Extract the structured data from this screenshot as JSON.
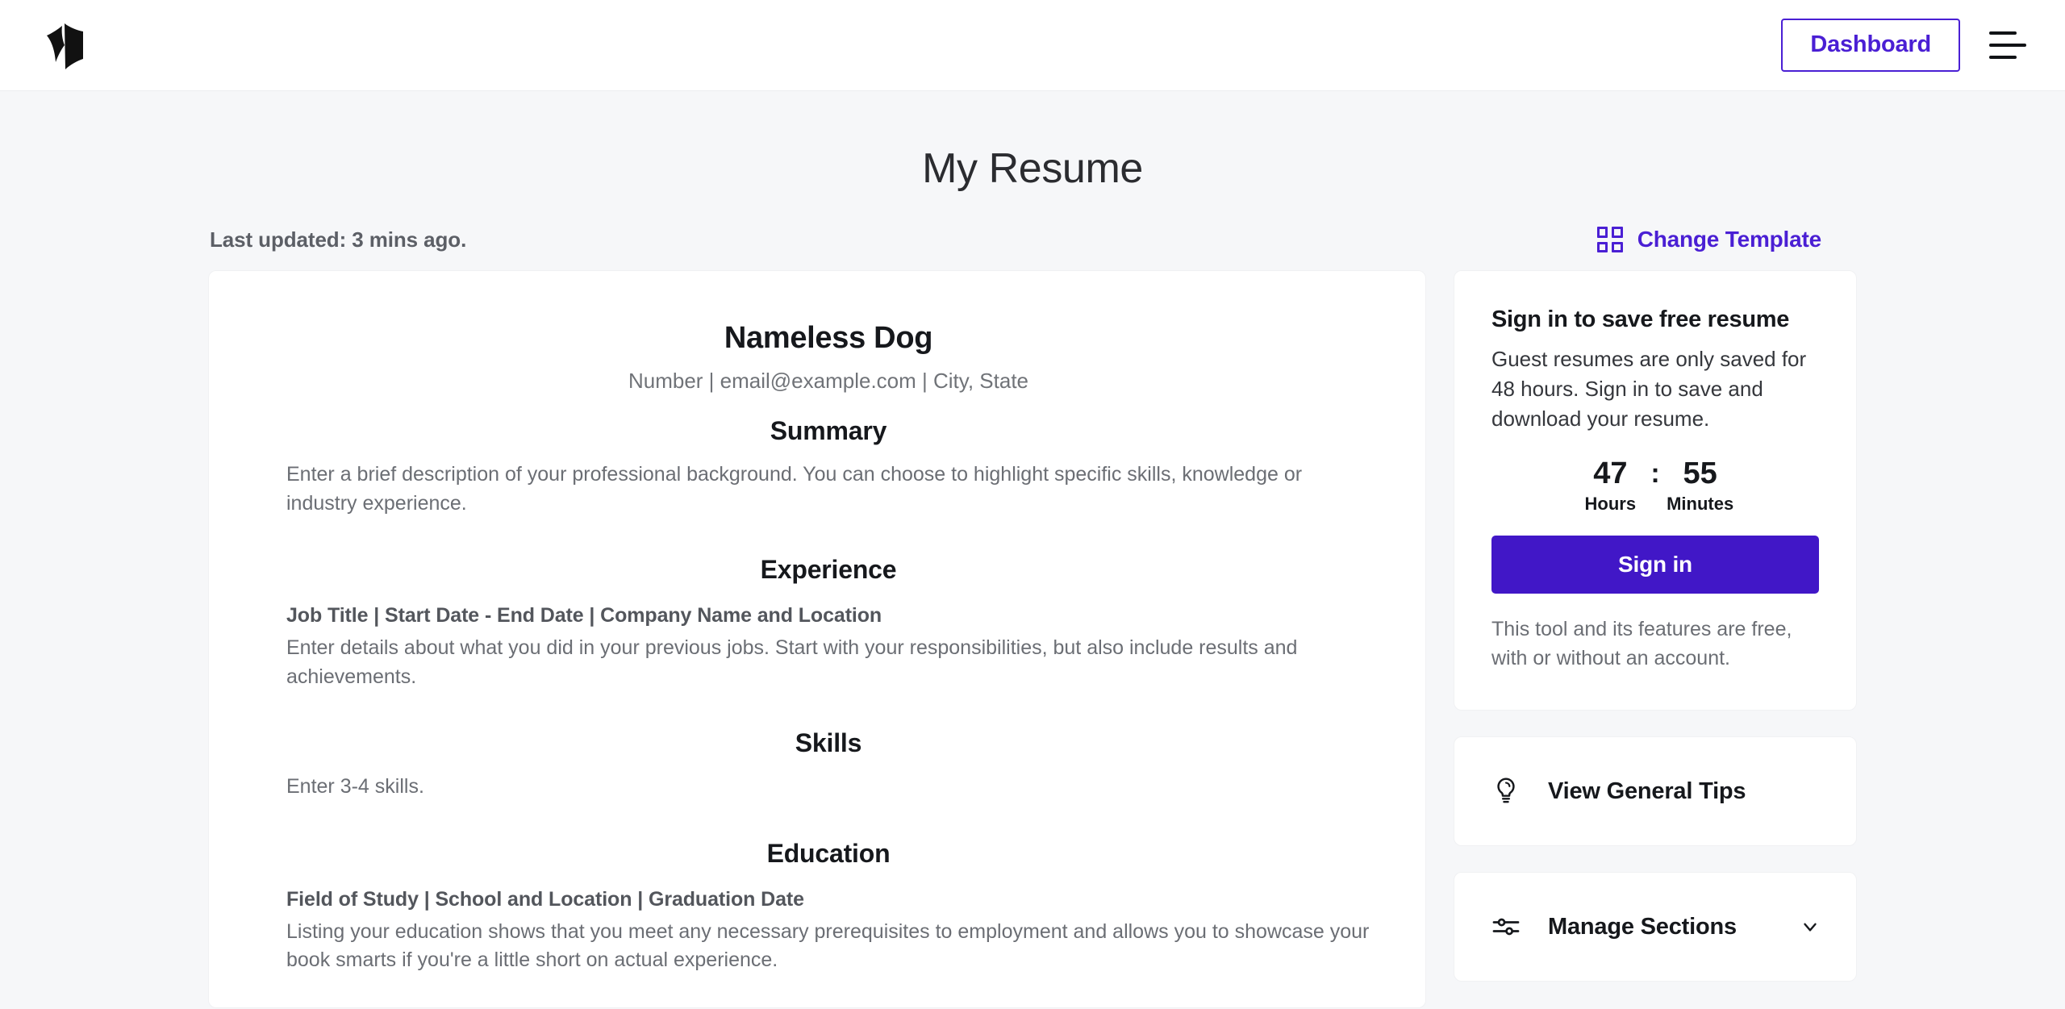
{
  "header": {
    "logo_icon": "book-logo-icon",
    "dashboard_label": "Dashboard",
    "menu_icon": "hamburger-menu-icon"
  },
  "page": {
    "title": "My Resume",
    "last_updated": "Last updated: 3 mins ago.",
    "change_template_label": "Change Template",
    "change_template_icon": "grid-template-icon"
  },
  "resume": {
    "name": "Nameless Dog",
    "contact": "Number | email@example.com | City, State",
    "sections": [
      {
        "title": "Summary",
        "body": "Enter a brief description of your professional background. You can choose to highlight specific skills, knowledge or industry experience."
      },
      {
        "title": "Experience",
        "subhead": "Job Title | Start Date - End Date | Company Name and Location",
        "body": "Enter details about what you did in your previous jobs. Start with your responsibilities, but also include results and achievements."
      },
      {
        "title": "Skills",
        "body": "Enter 3-4 skills."
      },
      {
        "title": "Education",
        "subhead": "Field of Study | School and Location | Graduation Date",
        "body": "Listing your education shows that you meet any necessary prerequisites to employment and allows you to showcase your book smarts if you're a little short on actual experience."
      }
    ]
  },
  "sidebar": {
    "signin_card": {
      "title": "Sign in to save free resume",
      "description": "Guest resumes are only saved for 48 hours. Sign in to save and download your resume.",
      "countdown": {
        "hours_value": "47",
        "separator": ":",
        "minutes_value": "55",
        "hours_label": "Hours",
        "minutes_label": "Minutes"
      },
      "button_label": "Sign in",
      "note": "This tool and its features are free, with or without an account."
    },
    "tips_card": {
      "label": "View General Tips",
      "icon": "lightbulb-icon"
    },
    "manage_card": {
      "label": "Manage Sections",
      "icon": "sliders-icon",
      "chevron_icon": "chevron-down-icon"
    }
  },
  "colors": {
    "accent_purple": "#4117c7",
    "link_purple": "#4a1fd4",
    "page_background": "#f6f7f9",
    "card_background": "#ffffff"
  }
}
